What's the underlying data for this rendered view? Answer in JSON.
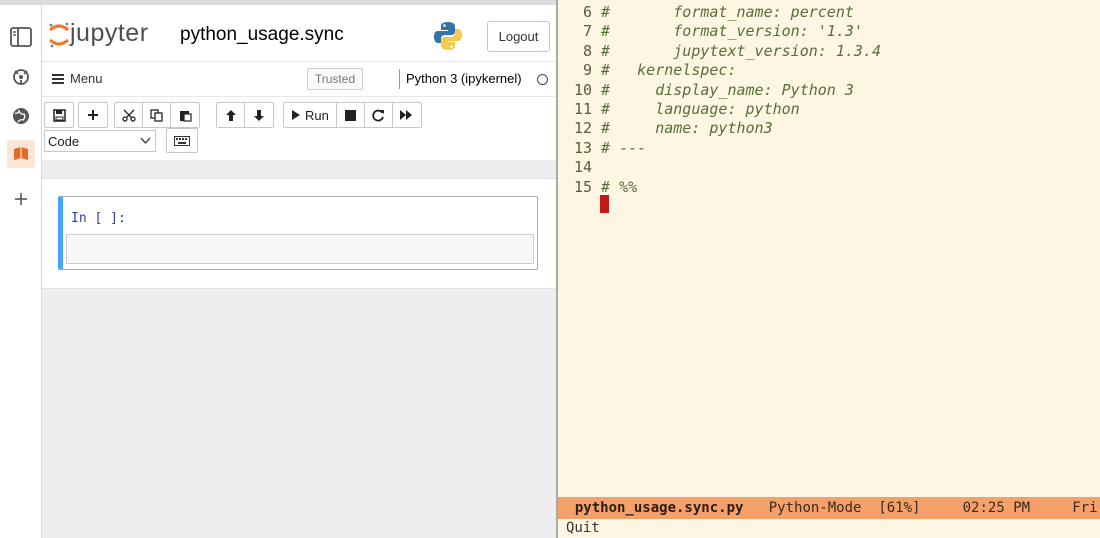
{
  "jupyter": {
    "logo_text": "jupyter",
    "notebook_name": "python_usage.sync",
    "logout_label": "Logout",
    "menu_label": "Menu",
    "trusted_label": "Trusted",
    "kernel_name": "Python 3 (ipykernel)",
    "run_label": "Run",
    "cell_type": "Code",
    "cell_prompt": "In [ ]:",
    "toolbar_icons": [
      "save-icon",
      "plus-icon",
      "cut-icon",
      "copy-icon",
      "paste-icon",
      "arrow-up-icon",
      "arrow-down-icon",
      "run-icon",
      "stop-icon",
      "restart-icon",
      "fast-forward-icon",
      "keyboard-icon"
    ],
    "sidebar_icons": [
      "file-browser-icon",
      "git-icon",
      "globe-icon",
      "book-icon",
      "plus-icon"
    ],
    "colors": {
      "cell_selected": "#42a5f5",
      "prompt": "#303f9f"
    }
  },
  "emacs": {
    "lines": [
      {
        "num": "6",
        "text": "#       format_name: percent"
      },
      {
        "num": "7",
        "text": "#       format_version: '1.3'"
      },
      {
        "num": "8",
        "text": "#       jupytext_version: 1.3.4"
      },
      {
        "num": "9",
        "text": "#   kernelspec:"
      },
      {
        "num": "10",
        "text": "#     display_name: Python 3"
      },
      {
        "num": "11",
        "text": "#     language: python"
      },
      {
        "num": "12",
        "text": "#     name: python3"
      },
      {
        "num": "13",
        "text": "# ---"
      },
      {
        "num": "14",
        "text": ""
      },
      {
        "num": "15",
        "text": "# %%"
      }
    ],
    "modeline": {
      "file": "python_usage.sync.py",
      "mode": "Python-Mode",
      "position": "[61%]",
      "time": "02:25 PM",
      "day": "Fri,"
    },
    "minibuffer": "Quit",
    "colors": {
      "background": "#fdf6e3",
      "modeline": "#f4a06a",
      "cursor": "#c41a16",
      "comment": "#586e3a"
    }
  }
}
